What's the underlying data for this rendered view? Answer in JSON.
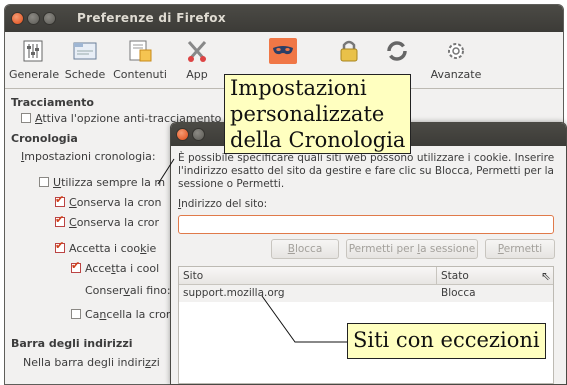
{
  "window": {
    "title": "Preferenze di Firefox"
  },
  "toolbar": {
    "items": [
      {
        "label": "Generale",
        "icon": "switches-icon"
      },
      {
        "label": "Schede",
        "icon": "tabs-icon"
      },
      {
        "label": "Contenuti",
        "icon": "content-icon"
      },
      {
        "label": "App",
        "icon": "applications-icon"
      },
      {
        "label": "",
        "icon": "privacy-mask-icon",
        "selected": true
      },
      {
        "label": "",
        "icon": "padlock-icon"
      },
      {
        "label": "",
        "icon": "sync-icon"
      },
      {
        "label": "Avanzate",
        "icon": "gear-icon"
      }
    ]
  },
  "prefs": {
    "tracking": {
      "title": "Tracciamento",
      "option_prefix": "A",
      "option_rest": "ttiva l'opzione anti-traccia",
      "option_tail": "mento"
    },
    "history": {
      "title": "Cronologia",
      "settings_prefix": "I",
      "settings_rest": "mpostazioni cronologia:",
      "options": [
        {
          "label_pre": "U",
          "label": "tilizza sempre la m",
          "checked": false
        },
        {
          "label_pre": "C",
          "label": "onserva la cron",
          "checked": true
        },
        {
          "label_pre": "C",
          "label": "onserva la cror",
          "checked": true
        },
        {
          "label_pre": "Accetta i coo",
          "label_under": "k",
          "label": "ie",
          "checked": true
        },
        {
          "label_pre": "Acce",
          "label_under": "t",
          "label": "ta i cool",
          "checked": true
        }
      ],
      "keep_until_pre": "Conser",
      "keep_until_under": "v",
      "keep_until_post": "ali fino:",
      "clear_pre": "Ca",
      "clear_under": "n",
      "clear_post": "cella la cronc"
    },
    "addressbar": {
      "title": "Barra degli indirizzi",
      "text_pre": "Nella barra degli indiri",
      "text_under": "z",
      "text_post": "zi"
    }
  },
  "dialog": {
    "description": "È possibile specificare quali siti web possono utilizzare i cookie. Inserire l'indirizzo esatto del sito da gestire e fare clic su Blocca, Permetti per la sessione o Permetti.",
    "site_label_pre": "I",
    "site_label_rest": "ndirizzo del sito:",
    "site_value": "",
    "buttons": {
      "block_under": "B",
      "block_rest": "locca",
      "session_pre": "Permetti per ",
      "session_under": "l",
      "session_rest": "a sessione",
      "allow_under": "P",
      "allow_rest": "ermetti"
    },
    "table": {
      "headers": [
        "Sito",
        "Stato"
      ],
      "rows": [
        {
          "site": "support.mozilla.org",
          "status": "Blocca"
        }
      ]
    }
  },
  "callouts": {
    "history_settings": [
      "Impostazioni",
      "personalizzate",
      "della Cronologia"
    ],
    "exceptions": "Siti con eccezioni"
  }
}
